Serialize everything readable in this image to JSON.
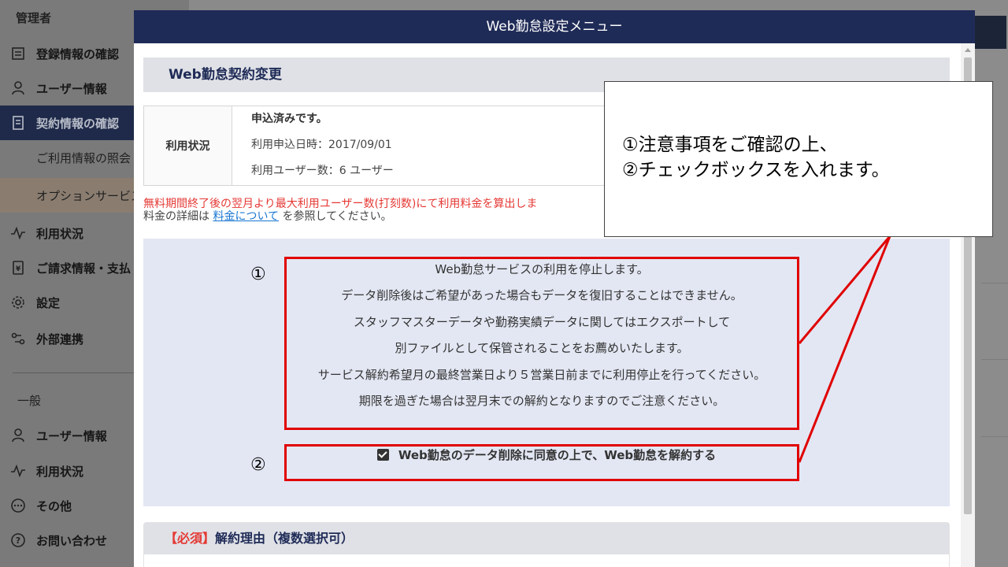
{
  "sidebar": {
    "admin_heading": "管理者",
    "items": [
      {
        "label": "登録情報の確認"
      },
      {
        "label": "ユーザー情報"
      },
      {
        "label": "契約情報の確認"
      },
      {
        "label": "ご利用情報の照会"
      },
      {
        "label": "オプションサービス"
      },
      {
        "label": "利用状況"
      },
      {
        "label": "ご請求情報・支払"
      },
      {
        "label": "設定"
      },
      {
        "label": "外部連携"
      }
    ],
    "general_heading": "一般",
    "general_items": [
      {
        "label": "ユーザー情報"
      },
      {
        "label": "利用状況"
      },
      {
        "label": "その他"
      },
      {
        "label": "お問い合わせ"
      }
    ]
  },
  "modal": {
    "title": "Web勤怠設定メニュー",
    "section_title": "Web勤怠契約変更",
    "status": {
      "label": "利用状況",
      "line1": "申込済みです。",
      "line2": "利用申込日時：2017/09/01",
      "line3": "利用ユーザー数：6 ユーザー"
    },
    "warning": "無料期間終了後の翌月より最大利用ユーザー数(打刻数)にて利用料金を算出しま",
    "fee_prefix": "料金の詳細は",
    "fee_link": "料金について",
    "fee_suffix": "を参照してください。",
    "notes": [
      "Web勤怠サービスの利用を停止します。",
      "データ削除後はご希望があった場合もデータを復旧することはできません。",
      "スタッフマスターデータや勤務実績データに関してはエクスポートして",
      "別ファイルとして保管されることをお薦めいたします。",
      "サービス解約希望月の最終営業日より５営業日前までに利用停止を行ってください。",
      "期限を過ぎた場合は翌月末での解約となりますのでご注意ください。"
    ],
    "agree_checked": true,
    "agree_label": "Web勤怠のデータ削除に同意の上で、Web勤怠を解約する",
    "reason_required": "【必須】",
    "reason_title": "解約理由（複数選択可）"
  },
  "annotation": {
    "marker1": "①",
    "marker2": "②",
    "callout_line1": "①注意事項をご確認の上、",
    "callout_line2": "②チェックボックスを入れます。",
    "color": "#e00000"
  }
}
